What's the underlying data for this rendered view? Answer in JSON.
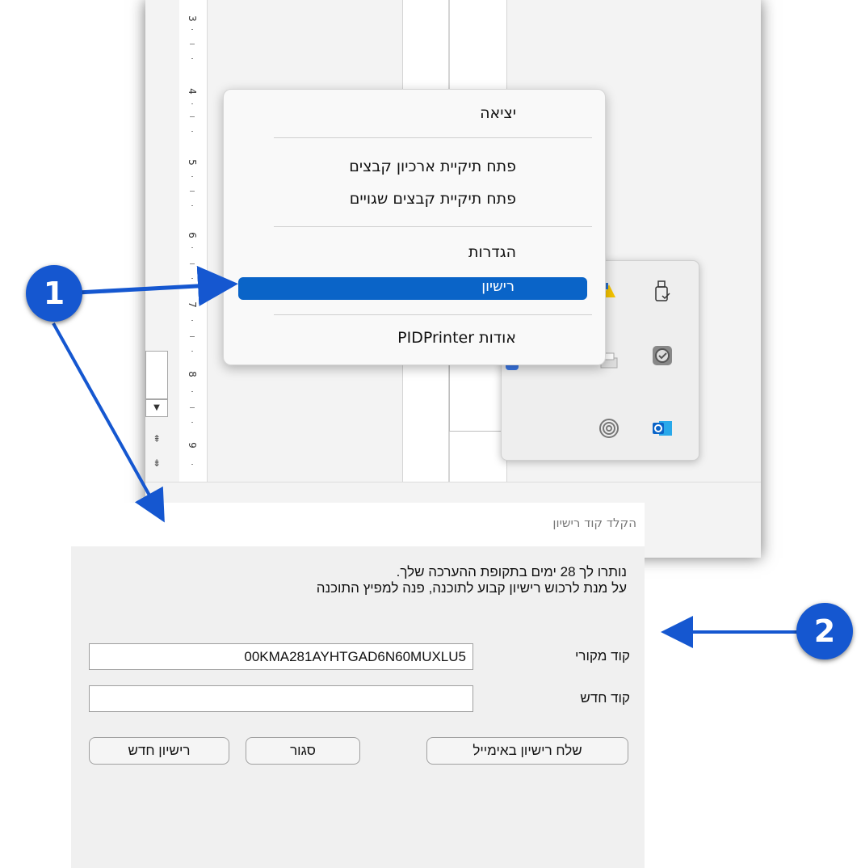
{
  "ruler": {
    "numbers": [
      "3",
      "4",
      "5",
      "6",
      "7",
      "8",
      "9"
    ]
  },
  "nav": {
    "prev_icon": "double-up-arrow-icon",
    "next_icon": "double-down-arrow-icon",
    "scroll_down_icon": "scroll-down-arrow-icon",
    "prev_glyph": "⇞",
    "next_glyph": "⇟",
    "scroll_down_glyph": "▼"
  },
  "context_menu": {
    "exit": "יציאה",
    "open_archive": "פתח תיקיית ארכיון קבצים",
    "open_errors": "פתח תיקיית קבצים שגויים",
    "settings": "הגדרות",
    "license": "רישיון",
    "about": "אודות PIDPrinter",
    "selected_color": "#0a64c8"
  },
  "tray": {
    "icons": [
      "usb-drive-icon",
      "warning-icon",
      "printer-icon",
      "sync-app-icon",
      "blue-app-icon",
      "fingerprint-icon",
      "outlook-icon"
    ]
  },
  "dialog": {
    "title": "הקלד קוד רישיון",
    "message_line1": "נותרו לך 28 ימים בתקופת ההערכה שלך.",
    "message_line2": "על מנת לרכוש רישיון קבוע לתוכנה, פנה למפיץ התוכנה",
    "original_code_label": "קוד מקורי",
    "original_code_value": "00KMA281AYHTGAD6N60MUXLU5",
    "new_code_label": "קוד חדש",
    "new_code_value": "",
    "send_email_button": "שלח רישיון באימייל",
    "close_button": "סגור",
    "new_license_button": "רישיון חדש"
  },
  "callouts": {
    "step1": "1",
    "step2": "2",
    "color": "#1557d0"
  }
}
